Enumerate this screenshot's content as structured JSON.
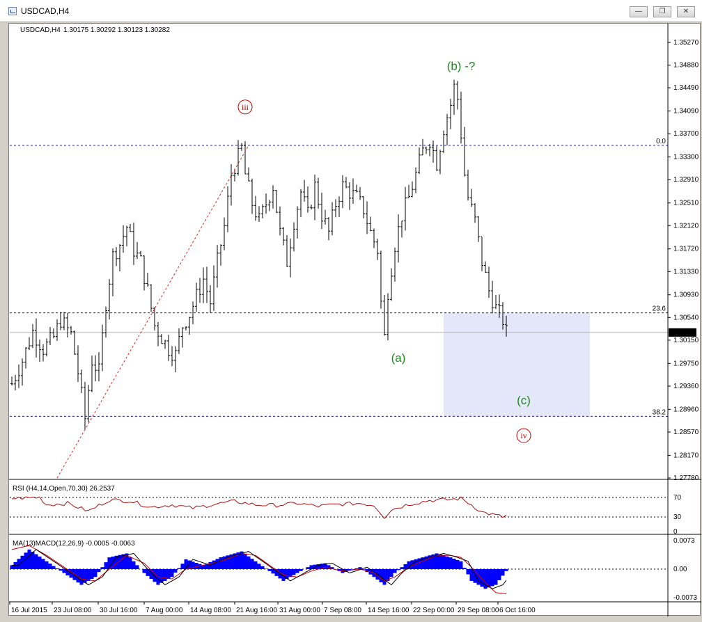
{
  "window": {
    "title": "USDCAD,H4"
  },
  "chart_header": {
    "symbol": "USDCAD,H4",
    "ohlc": "1.30175 1.30292 1.30123 1.30282"
  },
  "chart_data": {
    "type": "ohlc",
    "y_ticks": [
      "1.35270",
      "1.34880",
      "1.34490",
      "1.34090",
      "1.33700",
      "1.33300",
      "1.32910",
      "1.32510",
      "1.32120",
      "1.31720",
      "1.31330",
      "1.30930",
      "1.30540",
      "1.30150",
      "1.29750",
      "1.29360",
      "1.28960",
      "1.28570",
      "1.28170",
      "1.27780"
    ],
    "ylim": [
      1.2778,
      1.3527
    ],
    "current_price": "1.30282",
    "x_ticks": [
      "16 Jul 2015",
      "23 Jul 08:00",
      "30 Jul 16:00",
      "7 Aug 00:00",
      "14 Aug 08:00",
      "21 Aug 16:00",
      "31 Aug 00:00",
      "7 Sep 08:00",
      "14 Sep 16:00",
      "22 Sep 00:00",
      "29 Sep 08:00",
      "6 Oct 16:00"
    ],
    "fib_levels": [
      {
        "label": "0.0",
        "value": 1.335
      },
      {
        "label": "23.6",
        "value": 1.3062
      },
      {
        "label": "38.2",
        "value": 1.2884
      }
    ],
    "target_zone": {
      "from": 1.2884,
      "to": 1.3062
    },
    "price_path": [
      [
        0,
        1.294
      ],
      [
        3,
        1.298
      ],
      [
        6,
        1.303
      ],
      [
        9,
        1.3
      ],
      [
        12,
        1.302
      ],
      [
        14,
        1.305
      ],
      [
        17,
        1.3025
      ],
      [
        19,
        1.296
      ],
      [
        21,
        1.288
      ],
      [
        23,
        1.298
      ],
      [
        25,
        1.296
      ],
      [
        27,
        1.308
      ],
      [
        29,
        1.316
      ],
      [
        31,
        1.318
      ],
      [
        33,
        1.321
      ],
      [
        35,
        1.317
      ],
      [
        37,
        1.315
      ],
      [
        39,
        1.31
      ],
      [
        41,
        1.304
      ],
      [
        43,
        1.302
      ],
      [
        45,
        1.3
      ],
      [
        47,
        1.299
      ],
      [
        49,
        1.304
      ],
      [
        51,
        1.306
      ],
      [
        53,
        1.309
      ],
      [
        55,
        1.312
      ],
      [
        57,
        1.308
      ],
      [
        59,
        1.315
      ],
      [
        61,
        1.321
      ],
      [
        63,
        1.33
      ],
      [
        65,
        1.333
      ],
      [
        66,
        1.3345
      ],
      [
        67,
        1.33
      ],
      [
        69,
        1.325
      ],
      [
        71,
        1.322
      ],
      [
        73,
        1.325
      ],
      [
        75,
        1.328
      ],
      [
        77,
        1.32
      ],
      [
        79,
        1.315
      ],
      [
        81,
        1.322
      ],
      [
        83,
        1.327
      ],
      [
        85,
        1.323
      ],
      [
        87,
        1.328
      ],
      [
        89,
        1.323
      ],
      [
        91,
        1.32
      ],
      [
        93,
        1.325
      ],
      [
        95,
        1.328
      ],
      [
        97,
        1.327
      ],
      [
        99,
        1.326
      ],
      [
        101,
        1.324
      ],
      [
        103,
        1.32
      ],
      [
        105,
        1.317
      ],
      [
        106,
        1.308
      ],
      [
        107,
        1.302
      ],
      [
        108,
        1.31
      ],
      [
        110,
        1.318
      ],
      [
        112,
        1.323
      ],
      [
        114,
        1.326
      ],
      [
        116,
        1.33
      ],
      [
        118,
        1.334
      ],
      [
        120,
        1.336
      ],
      [
        122,
        1.332
      ],
      [
        124,
        1.338
      ],
      [
        126,
        1.342
      ],
      [
        127,
        1.345
      ],
      [
        128,
        1.343
      ],
      [
        129,
        1.337
      ],
      [
        130,
        1.33
      ],
      [
        131,
        1.326
      ],
      [
        133,
        1.322
      ],
      [
        135,
        1.315
      ],
      [
        137,
        1.31
      ],
      [
        139,
        1.307
      ],
      [
        141,
        1.305
      ],
      [
        142,
        1.3028
      ]
    ],
    "bar_count": 143,
    "wave_labels": [
      {
        "text": "iii",
        "circled": true,
        "color": "#cc0000",
        "bar": 67,
        "price": 1.341
      },
      {
        "text": "(b) -?",
        "circled": false,
        "color": "#1a8a1a",
        "bar": 129,
        "price": 1.348
      },
      {
        "text": "(a)",
        "circled": false,
        "color": "#1a8a1a",
        "bar": 111,
        "price": 1.2978
      },
      {
        "text": "(c)",
        "circled": false,
        "color": "#1a8a1a",
        "bar": 147,
        "price": 1.2905
      },
      {
        "text": "iv",
        "circled": true,
        "color": "#cc0000",
        "bar": 147,
        "price": 1.2845
      }
    ],
    "trendline": {
      "from": [
        13,
        1.2778
      ],
      "to": [
        68,
        1.335
      ]
    },
    "rsi": {
      "label": "RSI (H4,14,Open,70,30) 26.2537",
      "ticks": [
        "70",
        "30",
        "0"
      ],
      "levels": [
        70,
        30
      ],
      "path": [
        [
          0,
          68
        ],
        [
          8,
          70
        ],
        [
          10,
          55
        ],
        [
          16,
          58
        ],
        [
          22,
          42
        ],
        [
          28,
          65
        ],
        [
          34,
          63
        ],
        [
          40,
          50
        ],
        [
          46,
          55
        ],
        [
          52,
          48
        ],
        [
          58,
          56
        ],
        [
          64,
          62
        ],
        [
          70,
          55
        ],
        [
          76,
          54
        ],
        [
          82,
          58
        ],
        [
          88,
          52
        ],
        [
          94,
          56
        ],
        [
          100,
          58
        ],
        [
          104,
          54
        ],
        [
          107,
          30
        ],
        [
          109,
          45
        ],
        [
          114,
          56
        ],
        [
          120,
          64
        ],
        [
          126,
          66
        ],
        [
          129,
          68
        ],
        [
          132,
          55
        ],
        [
          135,
          40
        ],
        [
          138,
          35
        ],
        [
          141,
          30
        ],
        [
          142,
          33
        ]
      ]
    },
    "macd": {
      "label": "MA(13)MACD(12,26,9) -0.0005 -0.0063",
      "ticks": [
        "0.0073",
        "0.00",
        "-0.0073"
      ],
      "range": [
        -0.0078,
        0.0078
      ],
      "hist": [
        [
          0,
          0.001
        ],
        [
          5,
          0.005
        ],
        [
          10,
          0.002
        ],
        [
          15,
          -0.001
        ],
        [
          20,
          -0.004
        ],
        [
          24,
          -0.002
        ],
        [
          28,
          0.003
        ],
        [
          33,
          0.004
        ],
        [
          38,
          -0.001
        ],
        [
          42,
          -0.004
        ],
        [
          46,
          -0.002
        ],
        [
          50,
          0.0025
        ],
        [
          55,
          0.001
        ],
        [
          60,
          0.003
        ],
        [
          66,
          0.0045
        ],
        [
          70,
          0.002
        ],
        [
          74,
          -0.0005
        ],
        [
          78,
          -0.003
        ],
        [
          82,
          -0.001
        ],
        [
          86,
          0.001
        ],
        [
          90,
          0.0015
        ],
        [
          95,
          -0.001
        ],
        [
          100,
          0.0005
        ],
        [
          104,
          -0.002
        ],
        [
          107,
          -0.004
        ],
        [
          110,
          -0.001
        ],
        [
          114,
          0.002
        ],
        [
          118,
          0.003
        ],
        [
          122,
          0.004
        ],
        [
          126,
          0.003
        ],
        [
          129,
          0.002
        ],
        [
          132,
          -0.003
        ],
        [
          136,
          -0.005
        ],
        [
          139,
          -0.004
        ],
        [
          142,
          -0.0005
        ]
      ],
      "signal": [
        [
          0,
          0.005
        ],
        [
          5,
          0.006
        ],
        [
          10,
          0.0035
        ],
        [
          15,
          0.0005
        ],
        [
          20,
          -0.0025
        ],
        [
          24,
          -0.003
        ],
        [
          28,
          0.0
        ],
        [
          33,
          0.0035
        ],
        [
          38,
          0.0015
        ],
        [
          42,
          -0.002
        ],
        [
          46,
          -0.0025
        ],
        [
          50,
          0.0
        ],
        [
          55,
          0.001
        ],
        [
          60,
          0.002
        ],
        [
          66,
          0.004
        ],
        [
          70,
          0.0035
        ],
        [
          74,
          0.001
        ],
        [
          78,
          -0.0015
        ],
        [
          82,
          -0.002
        ],
        [
          86,
          -0.0005
        ],
        [
          90,
          0.0005
        ],
        [
          95,
          -0.0005
        ],
        [
          100,
          0.0
        ],
        [
          104,
          -0.001
        ],
        [
          107,
          -0.003
        ],
        [
          110,
          -0.002
        ],
        [
          114,
          0.0005
        ],
        [
          118,
          0.002
        ],
        [
          122,
          0.0035
        ],
        [
          126,
          0.0035
        ],
        [
          129,
          0.003
        ],
        [
          132,
          0.0005
        ],
        [
          136,
          -0.0035
        ],
        [
          139,
          -0.006
        ],
        [
          142,
          -0.0063
        ]
      ]
    }
  }
}
